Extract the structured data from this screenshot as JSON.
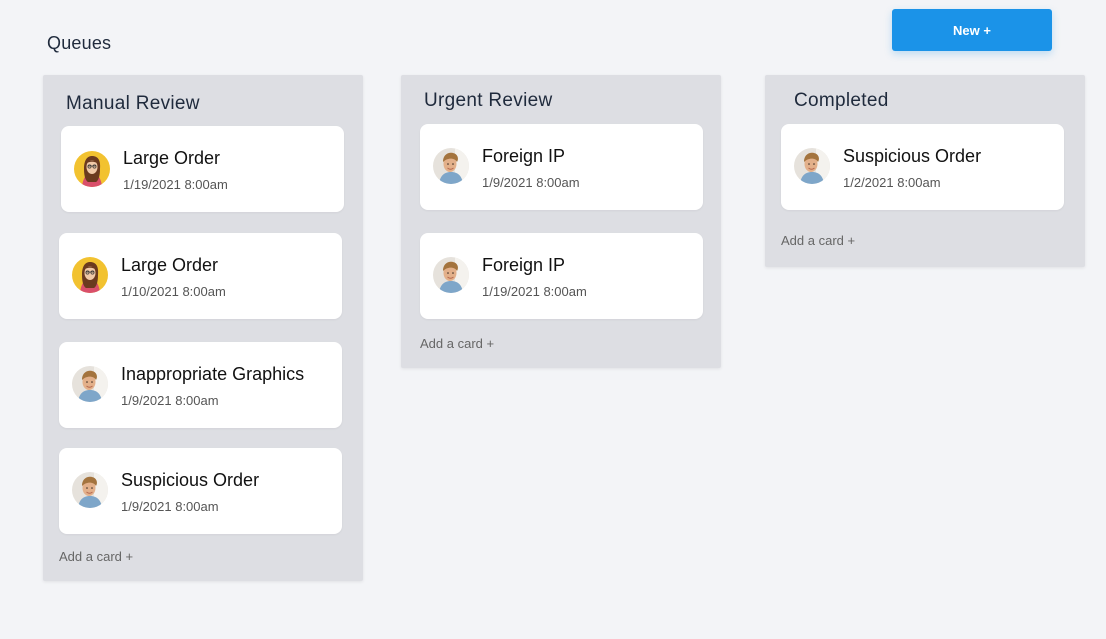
{
  "page": {
    "title": "Queues",
    "new_button_label": "New +"
  },
  "columns": [
    {
      "title": "Manual Review",
      "add_card_label": "Add a card +",
      "cards": [
        {
          "title": "Large Order",
          "date": "1/19/2021 8:00am",
          "avatar": "female-avatar"
        },
        {
          "title": "Large Order",
          "date": "1/10/2021 8:00am",
          "avatar": "female-avatar"
        },
        {
          "title": "Inappropriate Graphics",
          "date": "1/9/2021 8:00am",
          "avatar": "male-avatar"
        },
        {
          "title": "Suspicious Order",
          "date": "1/9/2021 8:00am",
          "avatar": "male-avatar"
        }
      ]
    },
    {
      "title": "Urgent Review",
      "add_card_label": "Add a card +",
      "cards": [
        {
          "title": "Foreign IP",
          "date": "1/9/2021 8:00am",
          "avatar": "male-avatar"
        },
        {
          "title": "Foreign IP",
          "date": "1/19/2021 8:00am",
          "avatar": "male-avatar"
        }
      ]
    },
    {
      "title": "Completed",
      "add_card_label": "Add a card +",
      "cards": [
        {
          "title": "Suspicious Order",
          "date": "1/2/2021 8:00am",
          "avatar": "male-avatar"
        }
      ]
    }
  ],
  "colors": {
    "accent": "#1b93e8",
    "background": "#f3f4f7",
    "column_background": "#dddee3",
    "card_background": "#ffffff"
  }
}
